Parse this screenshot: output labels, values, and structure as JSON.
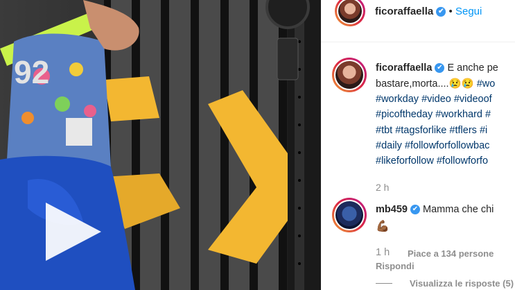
{
  "post": {
    "username": "ficoraffaella",
    "follow_label": "Segui",
    "dot": "•"
  },
  "caption": {
    "username": "ficoraffaella",
    "text_1": "E anche pe",
    "text_2": "bastare,morta....😢😢",
    "hashtags": [
      [
        "#wo"
      ],
      [
        "#workday",
        "#video",
        "#videoof"
      ],
      [
        "#picoftheday",
        "#workhard",
        "#"
      ],
      [
        "#tbt",
        "#tagsforlike",
        "#tflers",
        "#i"
      ],
      [
        "#daily",
        "#followforfollowbac"
      ],
      [
        "#likeforfollow",
        "#followforfo"
      ]
    ],
    "time": "2 h"
  },
  "comment": {
    "username": "mb459",
    "text": "Mamma che chi",
    "emoji": "💪🏾",
    "time": "1 h",
    "likes": "Piace a 134 persone",
    "reply_label": "Rispondi",
    "view_replies": "Visualizza le risposte (5)"
  },
  "icons": {
    "verified": "verified-badge-icon",
    "play": "play-icon"
  },
  "colors": {
    "link": "#00376b",
    "follow": "#0095f6",
    "verified": "#3897f0",
    "arrow_yellow": "#f3b731",
    "leggings": "#1f4fc0"
  }
}
